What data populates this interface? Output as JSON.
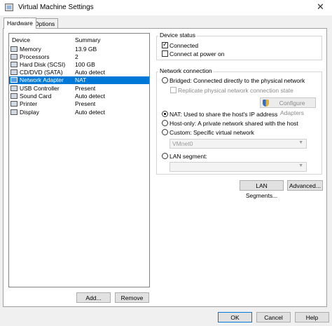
{
  "window": {
    "title": "Virtual Machine Settings",
    "close_glyph": "✕"
  },
  "tabs": [
    {
      "label": "Hardware",
      "active": true
    },
    {
      "label": "Options",
      "active": false
    }
  ],
  "device_list": {
    "headers": {
      "device": "Device",
      "summary": "Summary"
    },
    "rows": [
      {
        "name": "Memory",
        "summary": "13.9 GB",
        "icon": "memory-icon"
      },
      {
        "name": "Processors",
        "summary": "2",
        "icon": "processor-icon"
      },
      {
        "name": "Hard Disk (SCSI)",
        "summary": "100 GB",
        "icon": "hard-disk-icon"
      },
      {
        "name": "CD/DVD (SATA)",
        "summary": "Auto detect",
        "icon": "cd-dvd-icon"
      },
      {
        "name": "Network Adapter",
        "summary": "NAT",
        "icon": "network-adapter-icon",
        "selected": true
      },
      {
        "name": "USB Controller",
        "summary": "Present",
        "icon": "usb-icon"
      },
      {
        "name": "Sound Card",
        "summary": "Auto detect",
        "icon": "sound-card-icon"
      },
      {
        "name": "Printer",
        "summary": "Present",
        "icon": "printer-icon"
      },
      {
        "name": "Display",
        "summary": "Auto detect",
        "icon": "display-icon"
      }
    ],
    "add_label": "Add...",
    "remove_label": "Remove"
  },
  "device_status": {
    "legend": "Device status",
    "connected": {
      "label": "Connected",
      "checked": true
    },
    "connect_at_power_on": {
      "label": "Connect at power on",
      "checked": false
    }
  },
  "network_connection": {
    "legend": "Network connection",
    "bridged": {
      "label": "Bridged: Connected directly to the physical network",
      "checked": false
    },
    "replicate": {
      "label": "Replicate physical network connection state",
      "checked": false
    },
    "configure_adapters": "Configure Adapters",
    "nat": {
      "label": "NAT: Used to share the host's IP address",
      "checked": true
    },
    "host_only": {
      "label": "Host-only: A private network shared with the host",
      "checked": false
    },
    "custom": {
      "label": "Custom: Specific virtual network",
      "checked": false
    },
    "custom_value": "VMnet0",
    "lan_segment": {
      "label": "LAN segment:",
      "checked": false
    },
    "lan_segment_value": ""
  },
  "advanced_buttons": {
    "lan_segments": "LAN Segments...",
    "advanced": "Advanced..."
  },
  "footer": {
    "ok": "OK",
    "cancel": "Cancel",
    "help": "Help"
  }
}
